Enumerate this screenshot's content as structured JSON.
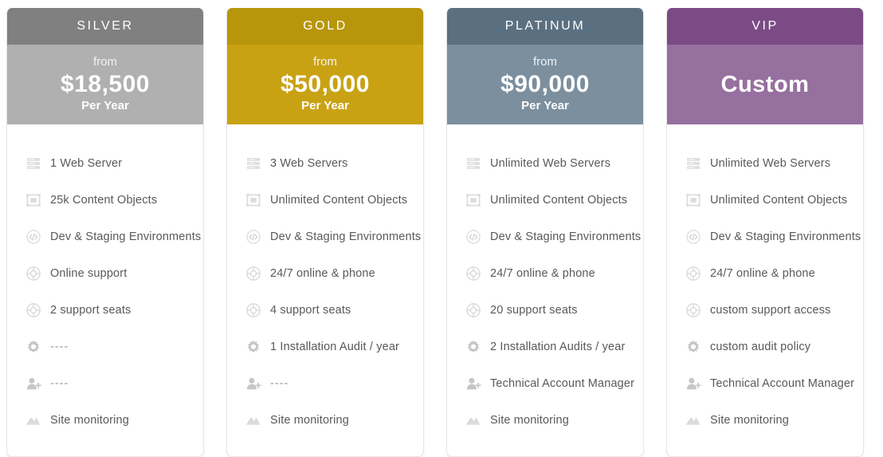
{
  "plans": [
    {
      "name": "SILVER",
      "title_color": "#808080",
      "price_color": "#b0b0b0",
      "from_label": "from",
      "price": "$18,500",
      "period": "Per Year",
      "show_from": true,
      "show_period": true,
      "features": [
        {
          "icon": "server-icon",
          "label": "1 Web Server",
          "placeholder": false
        },
        {
          "icon": "content-objects-icon",
          "label": "25k Content Objects",
          "placeholder": false
        },
        {
          "icon": "code-environments-icon",
          "label": "Dev & Staging Environments",
          "placeholder": false
        },
        {
          "icon": "lifebuoy-support-icon",
          "label": "Online support",
          "placeholder": false
        },
        {
          "icon": "lifebuoy-seats-icon",
          "label": "2 support seats",
          "placeholder": false
        },
        {
          "icon": "gear-audit-icon",
          "label": "----",
          "placeholder": true
        },
        {
          "icon": "person-add-icon",
          "label": "----",
          "placeholder": true
        },
        {
          "icon": "monitoring-chart-icon",
          "label": "Site monitoring",
          "placeholder": false
        }
      ]
    },
    {
      "name": "GOLD",
      "title_color": "#b8960c",
      "price_color": "#c9a213",
      "from_label": "from",
      "price": "$50,000",
      "period": "Per Year",
      "show_from": true,
      "show_period": true,
      "features": [
        {
          "icon": "server-icon",
          "label": "3 Web Servers",
          "placeholder": false
        },
        {
          "icon": "content-objects-icon",
          "label": "Unlimited Content Objects",
          "placeholder": false
        },
        {
          "icon": "code-environments-icon",
          "label": "Dev & Staging Environments",
          "placeholder": false
        },
        {
          "icon": "lifebuoy-support-icon",
          "label": "24/7 online & phone",
          "placeholder": false
        },
        {
          "icon": "lifebuoy-seats-icon",
          "label": "4 support seats",
          "placeholder": false
        },
        {
          "icon": "gear-audit-icon",
          "label": "1 Installation Audit / year",
          "placeholder": false
        },
        {
          "icon": "person-add-icon",
          "label": "----",
          "placeholder": true
        },
        {
          "icon": "monitoring-chart-icon",
          "label": "Site monitoring",
          "placeholder": false
        }
      ]
    },
    {
      "name": "PLATINUM",
      "title_color": "#5a7081",
      "price_color": "#7b8f9e",
      "from_label": "from",
      "price": "$90,000",
      "period": "Per Year",
      "show_from": true,
      "show_period": true,
      "features": [
        {
          "icon": "server-icon",
          "label": "Unlimited Web Servers",
          "placeholder": false
        },
        {
          "icon": "content-objects-icon",
          "label": "Unlimited Content Objects",
          "placeholder": false
        },
        {
          "icon": "code-environments-icon",
          "label": "Dev & Staging Environments",
          "placeholder": false
        },
        {
          "icon": "lifebuoy-support-icon",
          "label": "24/7 online & phone",
          "placeholder": false
        },
        {
          "icon": "lifebuoy-seats-icon",
          "label": "20 support seats",
          "placeholder": false
        },
        {
          "icon": "gear-audit-icon",
          "label": "2 Installation Audits / year",
          "placeholder": false
        },
        {
          "icon": "person-add-icon",
          "label": "Technical Account Manager",
          "placeholder": false
        },
        {
          "icon": "monitoring-chart-icon",
          "label": "Site monitoring",
          "placeholder": false
        }
      ]
    },
    {
      "name": "VIP",
      "title_color": "#7a4b85",
      "price_color": "#96709f",
      "from_label": "",
      "price": "Custom",
      "period": "",
      "show_from": false,
      "show_period": false,
      "features": [
        {
          "icon": "server-icon",
          "label": "Unlimited Web Servers",
          "placeholder": false
        },
        {
          "icon": "content-objects-icon",
          "label": "Unlimited Content Objects",
          "placeholder": false
        },
        {
          "icon": "code-environments-icon",
          "label": "Dev & Staging Environments",
          "placeholder": false
        },
        {
          "icon": "lifebuoy-support-icon",
          "label": "24/7 online & phone",
          "placeholder": false
        },
        {
          "icon": "lifebuoy-seats-icon",
          "label": "custom support access",
          "placeholder": false
        },
        {
          "icon": "gear-audit-icon",
          "label": "custom audit policy",
          "placeholder": false
        },
        {
          "icon": "person-add-icon",
          "label": "Technical Account Manager",
          "placeholder": false
        },
        {
          "icon": "monitoring-chart-icon",
          "label": "Site monitoring",
          "placeholder": false
        }
      ]
    }
  ],
  "icon_colors": {
    "light": "#dcdcdc",
    "medium": "#d2d2d2",
    "strong": "#c6c6c6"
  }
}
